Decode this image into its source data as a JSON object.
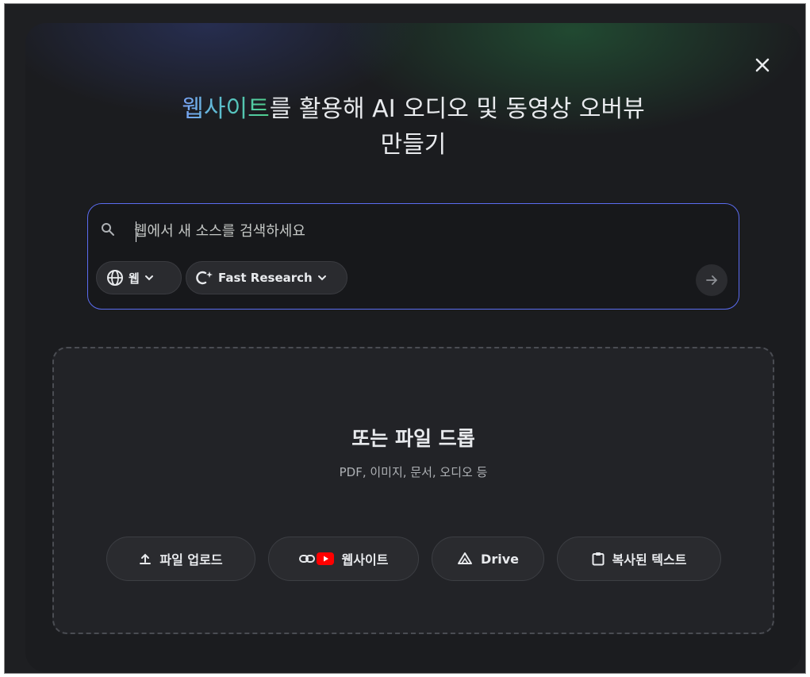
{
  "dialog": {
    "title_highlight": "웹사이트",
    "title_rest_line1": "를 활용해 AI 오디오 및 동영상 오버뷰",
    "title_line2": "만들기",
    "close_icon": "close-icon"
  },
  "search": {
    "placeholder": "웹에서 새 소스를 검색하세요",
    "source_chip_label": "웹",
    "mode_chip_label": "Fast Research",
    "accent_color": "#5b6cf0"
  },
  "drop_zone": {
    "title": "또는 파일 드롭",
    "subtitle": "PDF, 이미지, 문서, 오디오 등",
    "buttons": {
      "upload": "파일 업로드",
      "website": "웹사이트",
      "drive": "Drive",
      "paste": "복사된 텍스트"
    }
  }
}
